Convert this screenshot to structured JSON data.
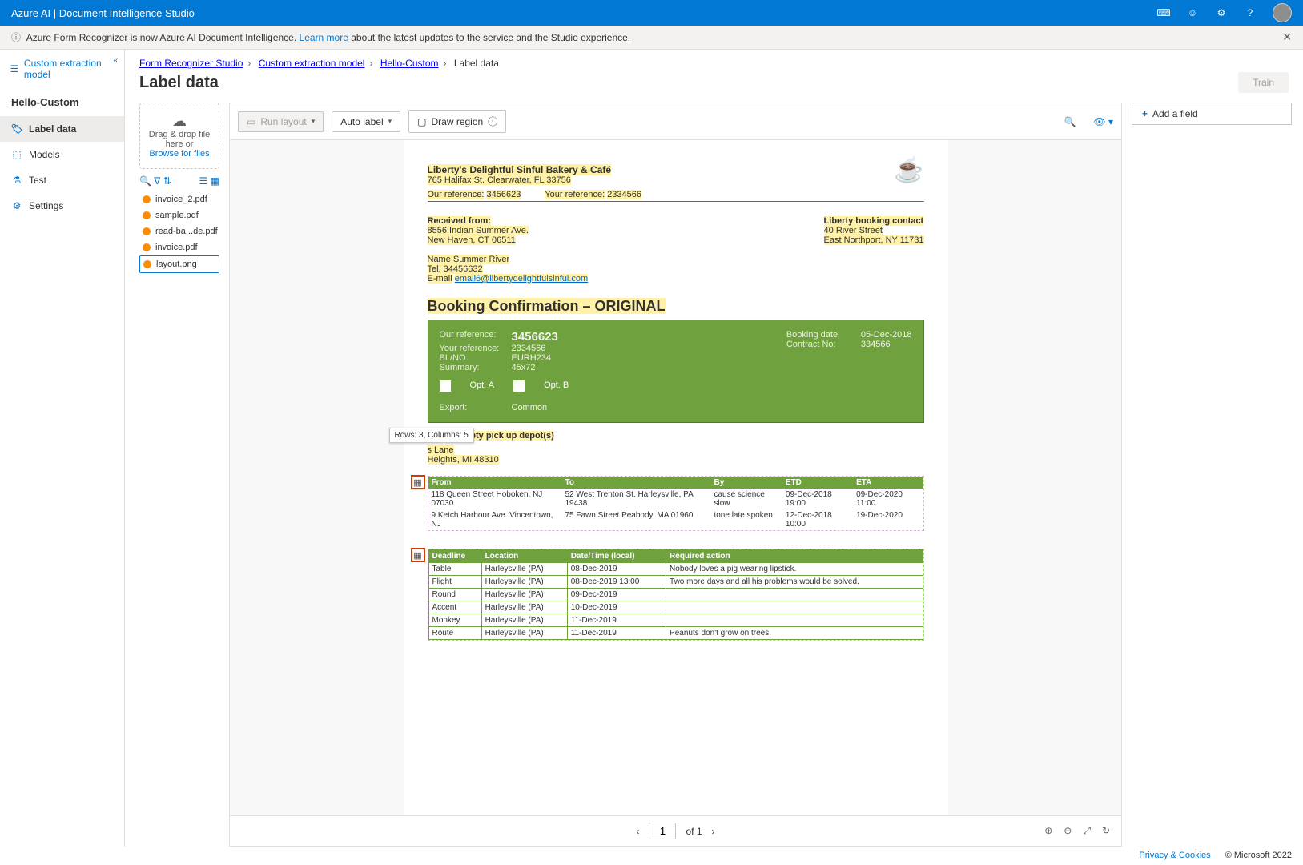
{
  "topbar": {
    "title": "Azure AI | Document Intelligence Studio"
  },
  "infobar": {
    "text_before": "Azure Form Recognizer is now Azure AI Document Intelligence. ",
    "link": "Learn more",
    "text_after": " about the latest updates to the service and the Studio experience."
  },
  "sidebar": {
    "header": "Custom extraction model",
    "project": "Hello-Custom",
    "items": [
      {
        "icon": "tag",
        "label": "Label data"
      },
      {
        "icon": "cube",
        "label": "Models"
      },
      {
        "icon": "flask",
        "label": "Test"
      },
      {
        "icon": "gear",
        "label": "Settings"
      }
    ]
  },
  "breadcrumb": [
    "Form Recognizer Studio",
    "Custom extraction model",
    "Hello-Custom",
    "Label data"
  ],
  "page_title": "Label data",
  "train_label": "Train",
  "dropzone": {
    "line1": "Drag & drop file here or",
    "link": "Browse for files"
  },
  "files": [
    "invoice_2.pdf",
    "sample.pdf",
    "read-ba...de.pdf",
    "invoice.pdf",
    "layout.png"
  ],
  "selected_file_index": 4,
  "doc_toolbar": {
    "run_layout": "Run layout",
    "auto_label": "Auto label",
    "draw_region": "Draw region"
  },
  "add_field": "Add a field",
  "pager": {
    "page": "1",
    "of": "of 1"
  },
  "tooltip": "Rows: 3, Columns: 5",
  "document": {
    "company": "Liberty's Delightful Sinful Bakery & Café",
    "address": "765 Halifax St. Clearwater, FL 33756",
    "our_ref_lbl": "Our reference:",
    "our_ref": "3456623",
    "your_ref_lbl": "Your reference:",
    "your_ref": "2334566",
    "received_from": "Received from:",
    "rf_line1": "8556 Indian Summer Ave.",
    "rf_line2": "New Haven, CT 06511",
    "rf_name": "Name Summer River",
    "rf_tel": "Tel. 34456632",
    "rf_email_lbl": "E-mail",
    "rf_email": "email6@libertydelightfulsinful.com",
    "contact_title": "Liberty booking contact",
    "contact_line1": "40 River Street",
    "contact_line2": "East Northport, NY 11731",
    "h1": "Booking Confirmation – ORIGINAL",
    "greenbox": {
      "our_ref_lbl": "Our reference:",
      "our_ref": "3456623",
      "your_ref_lbl": "Your reference:",
      "your_ref": "2334566",
      "blno_lbl": "BL/NO:",
      "blno": "EURH234",
      "summary_lbl": "Summary:",
      "summary": "45x72",
      "export_lbl": "Export:",
      "export": "Common",
      "booking_date_lbl": "Booking date:",
      "booking_date": "05-Dec-2018",
      "contract_no_lbl": "Contract No:",
      "contract_no": "334566",
      "opt_a": "Opt. A",
      "opt_b": "Opt. B"
    },
    "export_depot": "Export empty pick up depot(s)",
    "depot_line1": "s Lane",
    "depot_line2": "Heights, MI 48310",
    "table1": {
      "headers": [
        "From",
        "To",
        "By",
        "ETD",
        "ETA"
      ],
      "rows": [
        [
          "118 Queen Street Hoboken, NJ 07030",
          "52 West Trenton St. Harleysville, PA 19438",
          "cause science slow",
          "09-Dec-2018 19:00",
          "09-Dec-2020 11:00"
        ],
        [
          "9 Ketch Harbour Ave. Vincentown, NJ",
          "75 Fawn Street Peabody, MA 01960",
          "tone late spoken",
          "12-Dec-2018 10:00",
          "19-Dec-2020"
        ]
      ]
    },
    "table2": {
      "headers": [
        "Deadline",
        "Location",
        "Date/Time (local)",
        "Required action"
      ],
      "rows": [
        [
          "Table",
          "Harleysville (PA)",
          "08-Dec-2019",
          "Nobody loves a pig wearing lipstick."
        ],
        [
          "Flight",
          "Harleysville (PA)",
          "08-Dec-2019 13:00",
          "Two more days and all his problems would be solved."
        ],
        [
          "Round",
          "Harleysville (PA)",
          "09-Dec-2019",
          ""
        ],
        [
          "Accent",
          "Harleysville (PA)",
          "10-Dec-2019",
          ""
        ],
        [
          "Monkey",
          "Harleysville (PA)",
          "11-Dec-2019",
          ""
        ],
        [
          "Route",
          "Harleysville (PA)",
          "11-Dec-2019",
          "Peanuts don't grow on trees."
        ]
      ]
    }
  },
  "footer": {
    "privacy": "Privacy & Cookies",
    "copyright": "© Microsoft 2022"
  }
}
